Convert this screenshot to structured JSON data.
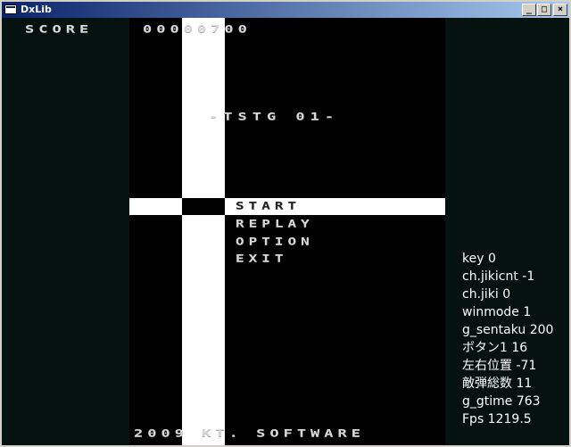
{
  "window": {
    "title": "DxLib",
    "minimize_glyph": "_",
    "maximize_glyph": "□",
    "close_glyph": "×"
  },
  "hud": {
    "score_label": "SCORE",
    "score_value": "00000700"
  },
  "stage": {
    "title": "-TSTG 01-"
  },
  "menu": {
    "items": [
      "START",
      "REPLAY",
      "OPTION",
      "EXIT"
    ],
    "selected": "START"
  },
  "footer": {
    "copyright": "2009 KT. SOFTWARE"
  },
  "debug": [
    "key 0",
    "ch.jikicnt -1",
    "ch.jiki 0",
    "winmode 1",
    "g_sentaku 200",
    "ボタン1 16",
    "左右位置 -71",
    "敵弾総数 11",
    "g_gtime 763",
    "Fps 1219.5"
  ],
  "colors": {
    "background": "#051210",
    "playfield": "#000000",
    "stripe": "#ffffff",
    "text": "#d8d8d8"
  }
}
